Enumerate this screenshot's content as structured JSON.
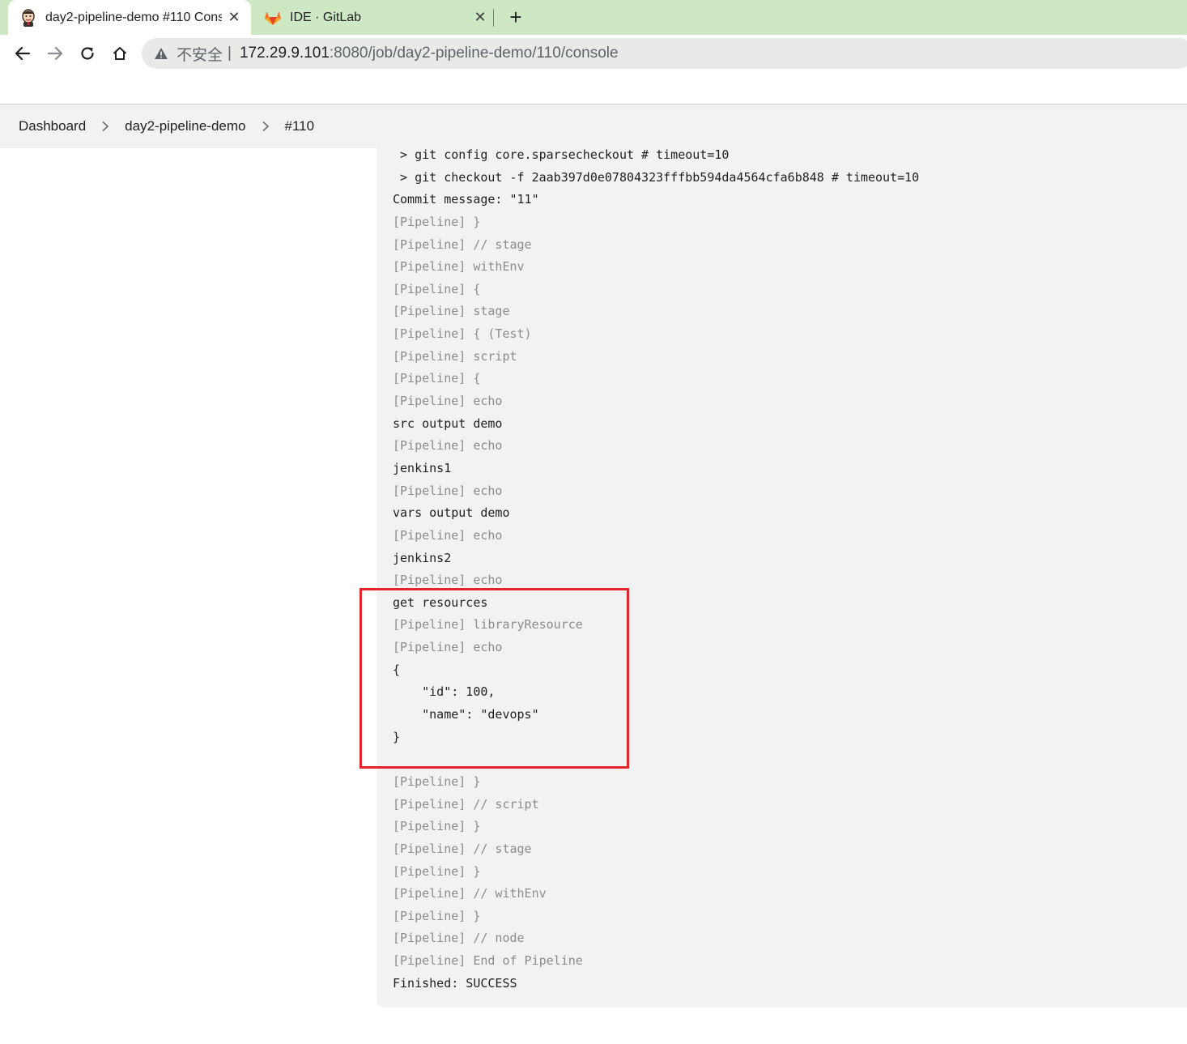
{
  "browser": {
    "tabs": [
      {
        "title": "day2-pipeline-demo #110 Console",
        "icon": "jenkins-icon",
        "active": true
      },
      {
        "title": "IDE · GitLab",
        "icon": "gitlab-icon",
        "active": false
      }
    ],
    "new_tab_label": "+",
    "close_label": "✕",
    "address_bar": {
      "security_label": "不安全",
      "divider": "|",
      "host": "172.29.9.101",
      "path": ":8080/job/day2-pipeline-demo/110/console"
    }
  },
  "breadcrumb": [
    {
      "label": "Dashboard"
    },
    {
      "label": "day2-pipeline-demo"
    },
    {
      "label": "#110"
    }
  ],
  "console": {
    "lines": [
      {
        "text": " > git config core.sparsecheckout # timeout=10",
        "kind": "out"
      },
      {
        "text": " > git checkout -f 2aab397d0e07804323fffbb594da4564cfa6b848 # timeout=10",
        "kind": "out"
      },
      {
        "text": "Commit message: \"11\"",
        "kind": "out"
      },
      {
        "text": "[Pipeline] }",
        "kind": "pipe"
      },
      {
        "text": "[Pipeline] // stage",
        "kind": "pipe"
      },
      {
        "text": "[Pipeline] withEnv",
        "kind": "pipe"
      },
      {
        "text": "[Pipeline] {",
        "kind": "pipe"
      },
      {
        "text": "[Pipeline] stage",
        "kind": "pipe"
      },
      {
        "text": "[Pipeline] { (Test)",
        "kind": "pipe"
      },
      {
        "text": "[Pipeline] script",
        "kind": "pipe"
      },
      {
        "text": "[Pipeline] {",
        "kind": "pipe"
      },
      {
        "text": "[Pipeline] echo",
        "kind": "pipe"
      },
      {
        "text": "src output demo",
        "kind": "out"
      },
      {
        "text": "[Pipeline] echo",
        "kind": "pipe"
      },
      {
        "text": "jenkins1",
        "kind": "out"
      },
      {
        "text": "[Pipeline] echo",
        "kind": "pipe"
      },
      {
        "text": "vars output demo",
        "kind": "out"
      },
      {
        "text": "[Pipeline] echo",
        "kind": "pipe"
      },
      {
        "text": "jenkins2",
        "kind": "out"
      },
      {
        "text": "[Pipeline] echo",
        "kind": "pipe"
      },
      {
        "text": "get resources",
        "kind": "out"
      },
      {
        "text": "[Pipeline] libraryResource",
        "kind": "pipe"
      },
      {
        "text": "[Pipeline] echo",
        "kind": "pipe"
      },
      {
        "text": "{",
        "kind": "out"
      },
      {
        "text": "    \"id\": 100,",
        "kind": "out"
      },
      {
        "text": "    \"name\": \"devops\"",
        "kind": "out"
      },
      {
        "text": "}",
        "kind": "out"
      },
      {
        "text": "",
        "kind": "out"
      },
      {
        "text": "[Pipeline] }",
        "kind": "pipe"
      },
      {
        "text": "[Pipeline] // script",
        "kind": "pipe"
      },
      {
        "text": "[Pipeline] }",
        "kind": "pipe"
      },
      {
        "text": "[Pipeline] // stage",
        "kind": "pipe"
      },
      {
        "text": "[Pipeline] }",
        "kind": "pipe"
      },
      {
        "text": "[Pipeline] // withEnv",
        "kind": "pipe"
      },
      {
        "text": "[Pipeline] }",
        "kind": "pipe"
      },
      {
        "text": "[Pipeline] // node",
        "kind": "pipe"
      },
      {
        "text": "[Pipeline] End of Pipeline",
        "kind": "pipe"
      },
      {
        "text": "Finished: SUCCESS",
        "kind": "out"
      }
    ]
  },
  "colors": {
    "tab_strip": "#cde8c3",
    "console_bg": "#f2f2f2",
    "pipeline_text": "#8c8c8c",
    "output_text": "#1f1f1f",
    "highlight": "#e3242b"
  }
}
